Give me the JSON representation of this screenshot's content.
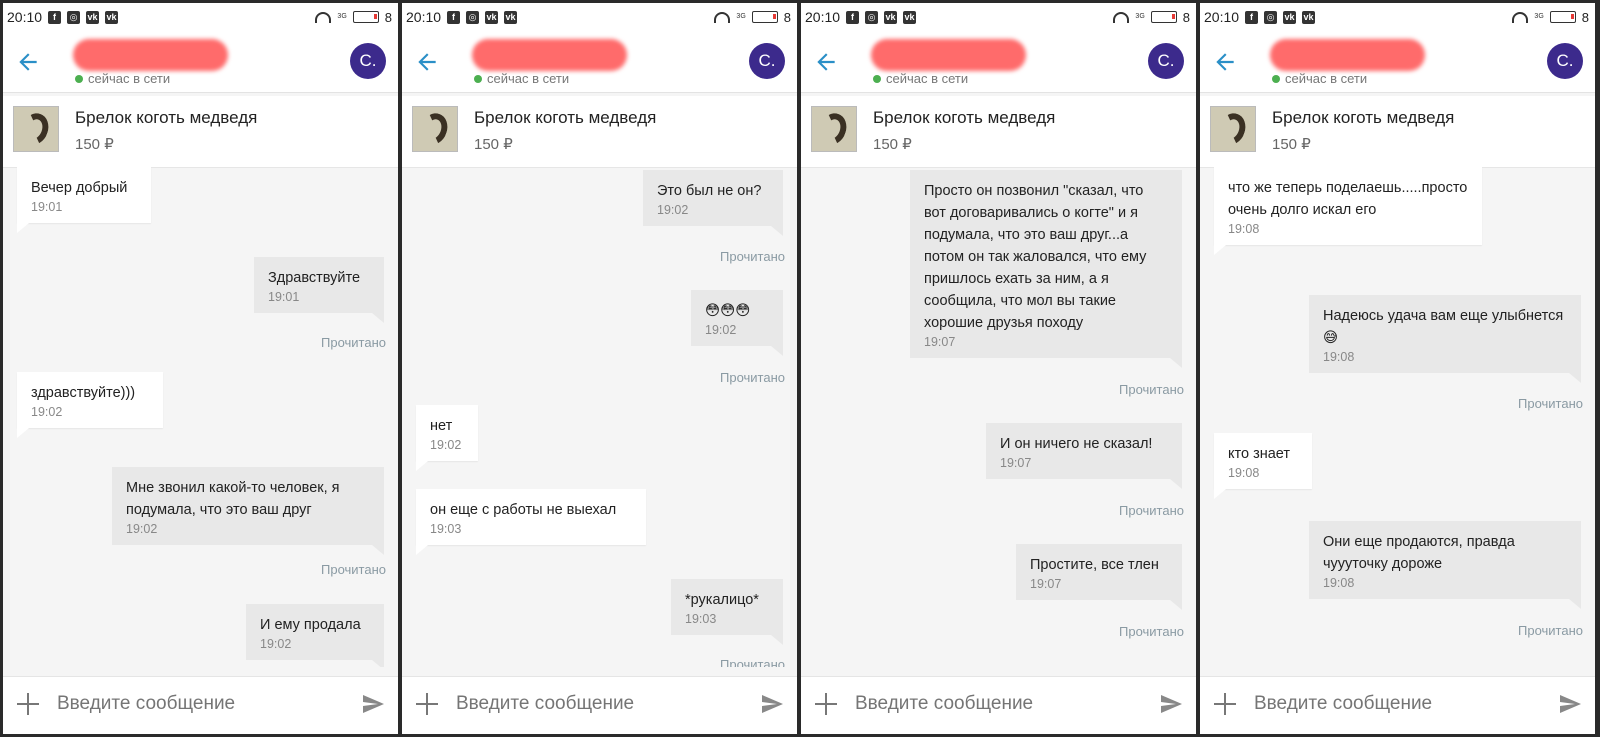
{
  "status": {
    "time": "20:10",
    "battery": "8",
    "net": "3G"
  },
  "header": {
    "status": "сейчас в сети",
    "avatar": "C."
  },
  "product": {
    "title": "Брелок коготь медведя",
    "price": "150 ₽"
  },
  "composer": {
    "placeholder": "Введите сообщение"
  },
  "read_label": "Прочитано",
  "panels": [
    {
      "messages": [
        {
          "dir": "in",
          "text": "Вечер добрый",
          "time": "19:01"
        },
        {
          "dir": "out",
          "text": "Здравствуйте",
          "time": "19:01",
          "read": true
        },
        {
          "dir": "in",
          "text": "здравствуйте)))",
          "time": "19:02"
        },
        {
          "dir": "out",
          "text": "Мне звонил какой-то человек, я подумала, что это ваш друг",
          "time": "19:02",
          "read": true
        },
        {
          "dir": "out",
          "text": "И ему продала",
          "time": "19:02"
        }
      ]
    },
    {
      "messages": [
        {
          "dir": "out",
          "text": "Это был не он?",
          "time": "19:02",
          "read": true
        },
        {
          "dir": "out",
          "text": "😳😳😳",
          "time": "19:02",
          "read": true
        },
        {
          "dir": "in",
          "text": "нет",
          "time": "19:02"
        },
        {
          "dir": "in",
          "text": "он еще с работы не выехал",
          "time": "19:03"
        },
        {
          "dir": "out",
          "text": "*рукалицо*",
          "time": "19:03",
          "read": true
        }
      ]
    },
    {
      "messages": [
        {
          "dir": "out",
          "text": "Просто он позвонил \"сказал, что вот договаривались о когте\" и я подумала, что это ваш друг...а потом он так жаловался, что ему пришлось ехать за ним, а я сообщила, что мол вы такие хорошие друзья походу",
          "time": "19:07",
          "read": true
        },
        {
          "dir": "out",
          "text": "И он ничего не сказал!",
          "time": "19:07",
          "read": true
        },
        {
          "dir": "out",
          "text": "Простите, все тлен",
          "time": "19:07",
          "read": true
        }
      ]
    },
    {
      "messages": [
        {
          "dir": "in",
          "text": "что же теперь поделаешь.....просто очень долго искал его",
          "time": "19:08"
        },
        {
          "dir": "out",
          "text": "Надеюсь удача вам еще улыбнется 😅",
          "time": "19:08",
          "read": true
        },
        {
          "dir": "in",
          "text": "кто знает",
          "time": "19:08"
        },
        {
          "dir": "out",
          "text": "Они еще продаются, правда чуууточку дороже",
          "time": "19:08",
          "read": true
        }
      ]
    }
  ]
}
